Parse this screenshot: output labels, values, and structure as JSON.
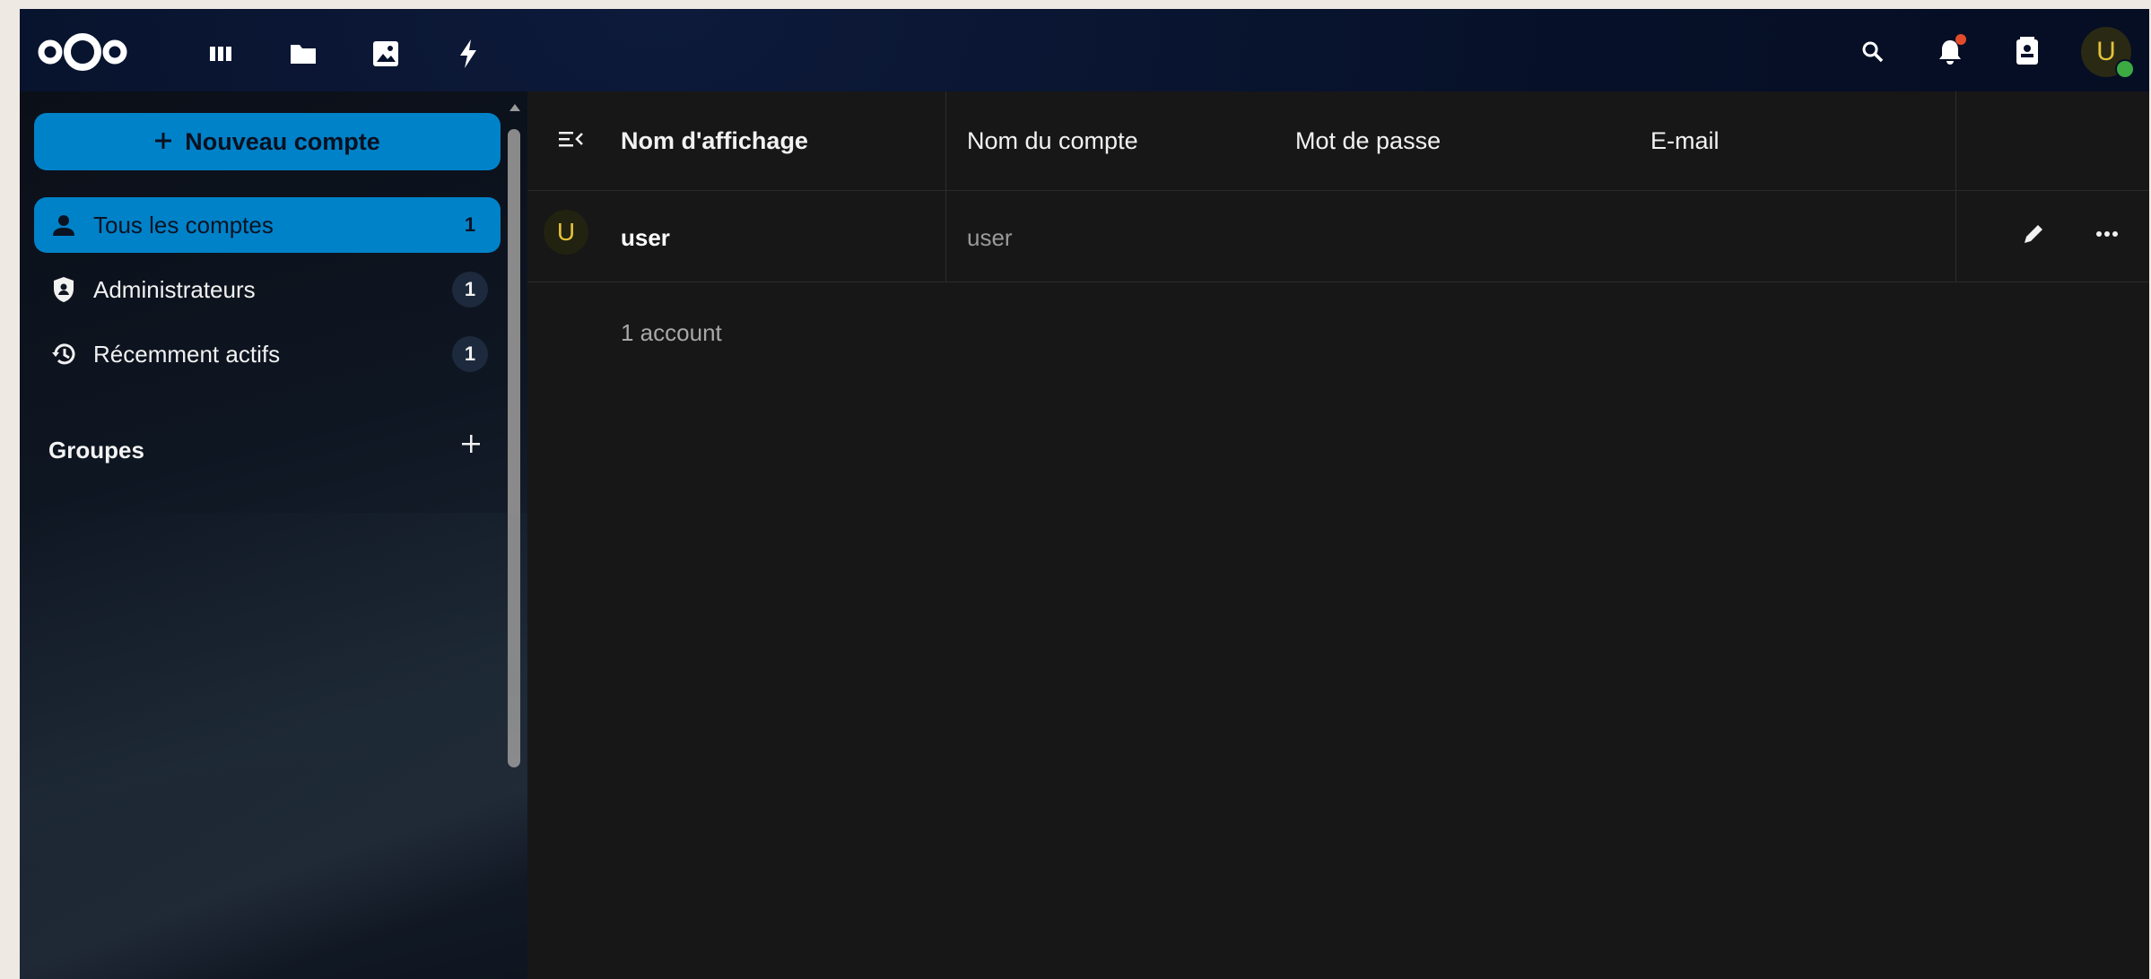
{
  "header": {
    "apps": [
      {
        "name": "dashboard",
        "icon": "dashboard-icon"
      },
      {
        "name": "files",
        "icon": "folder-icon"
      },
      {
        "name": "photos",
        "icon": "image-icon"
      },
      {
        "name": "activity",
        "icon": "lightning-icon"
      }
    ],
    "avatar_initial": "U"
  },
  "sidebar": {
    "new_account_label": "Nouveau compte",
    "items": [
      {
        "label": "Tous les comptes",
        "count": "1",
        "icon": "user-icon",
        "active": true
      },
      {
        "label": "Administrateurs",
        "count": "1",
        "icon": "shield-account-icon",
        "active": false
      },
      {
        "label": "Récemment actifs",
        "count": "1",
        "icon": "history-icon",
        "active": false
      }
    ],
    "groups_caption": "Groupes"
  },
  "table": {
    "columns": {
      "display_name": "Nom d'affichage",
      "account_name": "Nom du compte",
      "password": "Mot de passe",
      "email": "E-mail"
    },
    "rows": [
      {
        "avatar_initial": "U",
        "display_name": "user",
        "account_name": "user"
      }
    ],
    "footer": "1 account"
  },
  "colors": {
    "accent": "#0082c9",
    "avatar_text": "#e3c23a",
    "status_online": "#3bab42",
    "notification": "#e34c2b"
  }
}
